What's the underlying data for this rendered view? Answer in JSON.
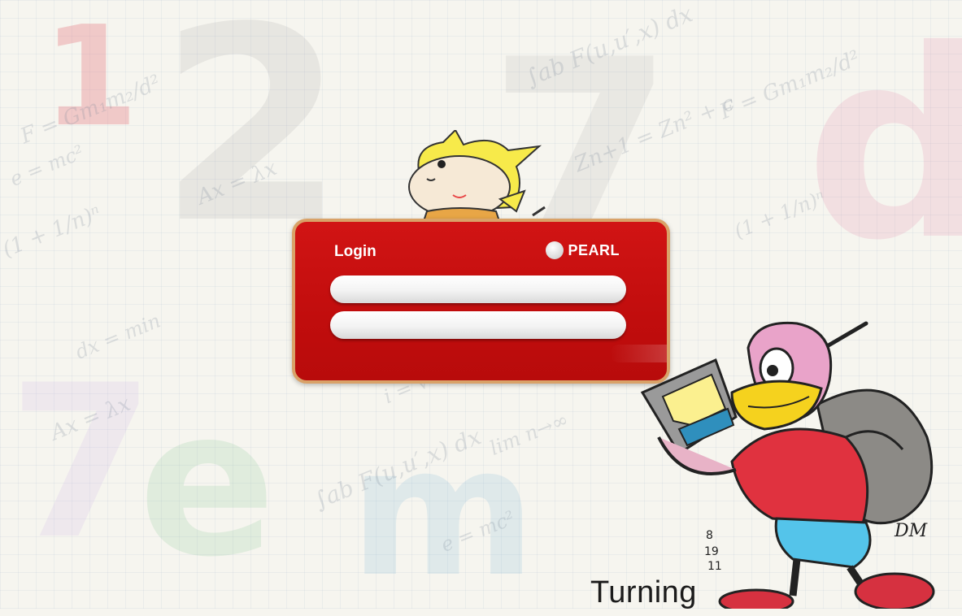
{
  "login": {
    "title": "Login",
    "brand": "PEARL",
    "username_value": "",
    "password_value": ""
  },
  "background": {
    "glyphs": [
      "1",
      "2",
      "7",
      "d",
      "e",
      "m",
      "7"
    ],
    "formulas": [
      "F = Gm₁m₂/d²",
      "Ax = λx",
      "∫ab F(u,u′,x) dx",
      "e = mc²",
      "(1 + 1/n)ⁿ",
      "Zn+1 = Zn² + c",
      "lim n→∞",
      "i = √-1",
      "dx = min"
    ]
  },
  "footer": {
    "brand_text": "Turning",
    "signature": "DM",
    "date": "8/19/11"
  },
  "colors": {
    "panel_red": "#c91010",
    "panel_border": "#d9a268",
    "background": "#f6f5ef"
  }
}
